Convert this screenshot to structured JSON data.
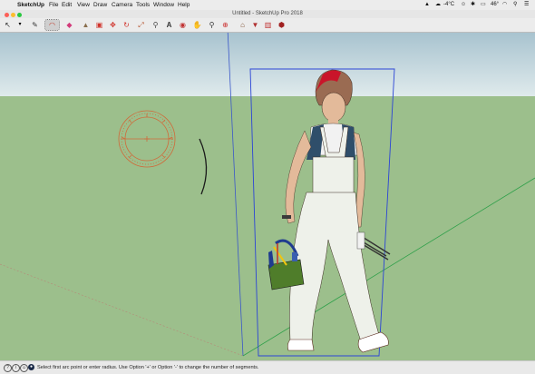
{
  "menubar": {
    "app_name": "SketchUp",
    "items": [
      "File",
      "Edit",
      "View",
      "Draw",
      "Camera",
      "Tools",
      "Window",
      "Help"
    ],
    "weather": "-4°C",
    "battery": "46°"
  },
  "window": {
    "title": "Untitled - SketchUp Pro 2018"
  },
  "toolbar": {
    "tools": [
      {
        "name": "select-tool",
        "glyph": "↖",
        "color": "#222222"
      },
      {
        "name": "pencil-tool",
        "glyph": "✎",
        "color": "#333333"
      },
      {
        "name": "arc-tool",
        "glyph": "◠",
        "color": "#c0392b",
        "active": true
      },
      {
        "name": "eraser-tool",
        "glyph": "◆",
        "color": "#d23a7a"
      },
      {
        "name": "paint-bucket-tool",
        "glyph": "▲",
        "color": "#8a6f4e"
      },
      {
        "name": "push-pull-tool",
        "glyph": "▣",
        "color": "#d0342c"
      },
      {
        "name": "move-tool",
        "glyph": "✥",
        "color": "#d0342c"
      },
      {
        "name": "rotate-tool",
        "glyph": "↻",
        "color": "#d0342c"
      },
      {
        "name": "scale-tool",
        "glyph": "⤢",
        "color": "#b5532e"
      },
      {
        "name": "tape-measure-tool",
        "glyph": "⚲",
        "color": "#444444"
      },
      {
        "name": "text-tool",
        "glyph": "A",
        "color": "#333333"
      },
      {
        "name": "orbit-tool",
        "glyph": "◉",
        "color": "#c03030"
      },
      {
        "name": "pan-tool",
        "glyph": "✋",
        "color": "#b08040"
      },
      {
        "name": "zoom-tool",
        "glyph": "⚲",
        "color": "#333333"
      },
      {
        "name": "zoom-extents-tool",
        "glyph": "⊕",
        "color": "#cc3333"
      },
      {
        "name": "3d-warehouse-icon",
        "glyph": "⌂",
        "color": "#7a4a2a"
      },
      {
        "name": "extension-warehouse-icon",
        "glyph": "▼",
        "color": "#b03030"
      },
      {
        "name": "layout-icon",
        "glyph": "▥",
        "color": "#c03030"
      },
      {
        "name": "extension-manager-icon",
        "glyph": "⬢",
        "color": "#a02020"
      }
    ]
  },
  "status": {
    "message": "Select first arc point or enter radius. Use Option '+' or Option '-' to change the number of segments."
  }
}
